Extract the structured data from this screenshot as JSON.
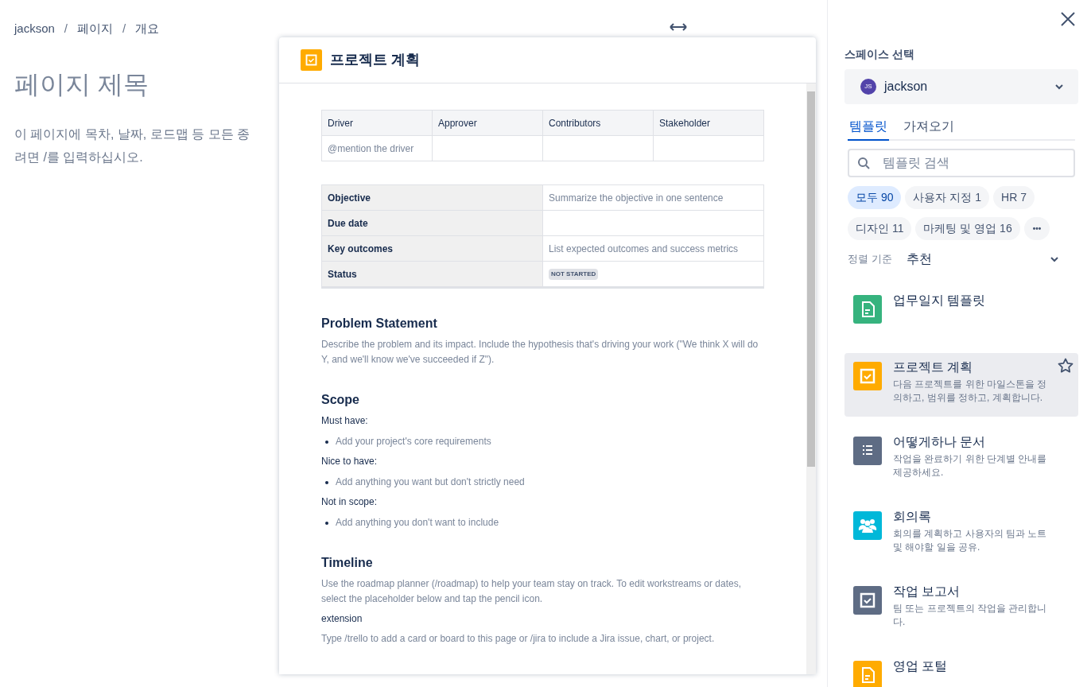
{
  "breadcrumb": [
    "jackson",
    "페이지",
    "개요"
  ],
  "breadcrumb_separator": "/",
  "page": {
    "title": "페이지 제목",
    "body_lines": [
      "이 페이지에 목차, 날짜, 로드맵 등 모든 종",
      "려면 /를 입력하십시오."
    ]
  },
  "preview": {
    "title": "프로젝트 계획",
    "people_table": {
      "columns": [
        "Driver",
        "Approver",
        "Contributors",
        "Stakeholder"
      ],
      "rows": [
        [
          "@mention the driver",
          "",
          "",
          ""
        ]
      ]
    },
    "info_table": [
      {
        "label": "Objective",
        "value": "Summarize the objective in one sentence",
        "kind": "text"
      },
      {
        "label": "Due date",
        "kind": "text"
      },
      {
        "label": "Key outcomes",
        "value": "List expected outcomes and success metrics",
        "kind": "text"
      },
      {
        "label": "Status",
        "value": "NOT STARTED",
        "kind": "lozenge"
      }
    ],
    "sections": [
      {
        "heading": "Problem Statement",
        "blocks": [
          {
            "kind": "hint",
            "text": "Describe the problem and its impact. Include the hypothesis that's driving your work (\"We think X will do Y, and we'll know we've succeeded if Z\")."
          }
        ]
      },
      {
        "heading": "Scope",
        "blocks": [
          {
            "kind": "label",
            "text": "Must have:"
          },
          {
            "kind": "bullet",
            "text": "Add your project's core requirements"
          },
          {
            "kind": "label",
            "text": "Nice to have:"
          },
          {
            "kind": "bullet",
            "text": "Add anything you want but don't strictly need"
          },
          {
            "kind": "label",
            "text": "Not in scope:"
          },
          {
            "kind": "bullet",
            "text": "Add anything you don't want to include"
          }
        ]
      },
      {
        "heading": "Timeline",
        "blocks": [
          {
            "kind": "hint",
            "text": "Use the roadmap planner (/roadmap) to help your team stay on track. To edit workstreams or dates, select the placeholder below and tap the pencil icon."
          },
          {
            "kind": "label",
            "text": "extension"
          },
          {
            "kind": "hint",
            "text": "Type /trello to add a card or board to this page or /jira to include a Jira issue, chart, or project."
          }
        ]
      }
    ]
  },
  "sidebar": {
    "space_label": "스페이스 선택",
    "space": {
      "initials": "JS",
      "name": "jackson"
    },
    "tabs": [
      {
        "label": "템플릿",
        "selected": true
      },
      {
        "label": "가져오기",
        "selected": false
      }
    ],
    "search": {
      "placeholder": "템플릿 검색"
    },
    "categories": [
      {
        "label": "모두",
        "count": "90",
        "selected": true
      },
      {
        "label": "사용자 지정",
        "count": "1",
        "selected": false
      },
      {
        "label": "HR",
        "count": "7",
        "selected": false
      },
      {
        "label": "디자인",
        "count": "11",
        "selected": false
      },
      {
        "label": "마케팅 및 영업",
        "count": "16",
        "selected": false
      }
    ],
    "more": "•••",
    "sort": {
      "label": "정렬 기준",
      "value": "추천"
    },
    "templates": [
      {
        "title": "업무일지 템플릿",
        "kind": "doc",
        "color": "#36b37e",
        "selected": false
      },
      {
        "title": "프로젝트 계획",
        "description": "다음 프로젝트를 위한 마일스톤을 정의하고, 범위를 정하고, 계획합니다.",
        "kind": "check",
        "color": "#ffab00",
        "selected": true
      },
      {
        "title": "어떻게하나 문서",
        "description": "작업을 완료하기 위한 단계별 안내를 제공하세요.",
        "kind": "list",
        "color": "#5e6c84",
        "selected": false
      },
      {
        "title": "회의록",
        "description": "회의를 계획하고 사용자의 팀과 노트 및 해야할 일을 공유.",
        "kind": "people",
        "color": "#00b8d9",
        "selected": false
      },
      {
        "title": "작업 보고서",
        "description": "팀 또는 프로젝트의 작업을 관리합니다.",
        "kind": "check",
        "color": "#5e6c84",
        "selected": false
      },
      {
        "title": "영업 포털",
        "kind": "doc",
        "color": "#ffab00",
        "selected": false
      }
    ]
  }
}
